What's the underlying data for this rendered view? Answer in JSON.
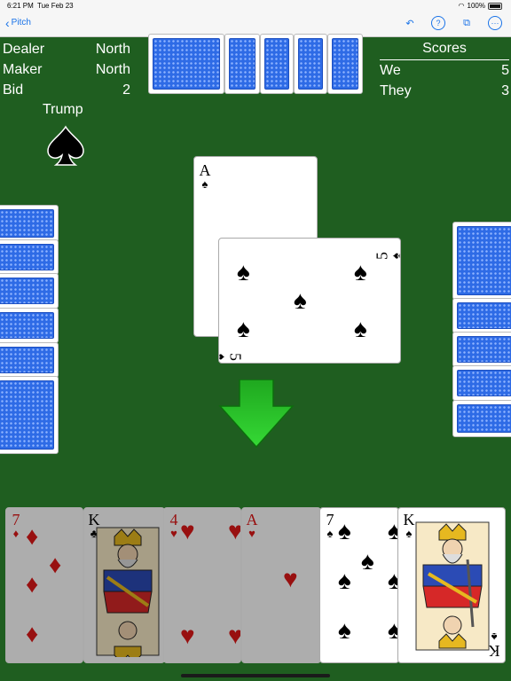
{
  "status": {
    "time": "6:21 PM",
    "date": "Tue Feb 23",
    "battery": "100%"
  },
  "nav": {
    "back_label": "Pitch",
    "icons": [
      "undo-icon",
      "help-icon",
      "deal-icon",
      "more-icon"
    ]
  },
  "game_info": {
    "dealer_label": "Dealer",
    "dealer_value": "North",
    "maker_label": "Maker",
    "maker_value": "North",
    "bid_label": "Bid",
    "bid_value": "2",
    "trump_label": "Trump",
    "trump_suit": "♠"
  },
  "scores": {
    "title": "Scores",
    "we_label": "We",
    "we_value": "5",
    "they_label": "They",
    "they_value": "3"
  },
  "trick": [
    {
      "rank": "A",
      "suit": "♠",
      "center_pip": ""
    },
    {
      "rank": "5",
      "suit": "♠",
      "pips": [
        "♠",
        "♠",
        "♠",
        "♠",
        "♠"
      ]
    }
  ],
  "hand": [
    {
      "rank": "7",
      "suit": "♦",
      "color": "red",
      "playable": false
    },
    {
      "rank": "K",
      "suit": "♣",
      "color": "black",
      "playable": false
    },
    {
      "rank": "4",
      "suit": "♥",
      "color": "red",
      "playable": false
    },
    {
      "rank": "A",
      "suit": "♥",
      "color": "red",
      "playable": false
    },
    {
      "rank": "7",
      "suit": "♠",
      "color": "black",
      "playable": true
    },
    {
      "rank": "K",
      "suit": "♠",
      "color": "black",
      "playable": true
    }
  ],
  "colors": {
    "felt": "#1f5e20",
    "card_back": "#2e6be6",
    "arrow": "#20b020",
    "accent": "#1a73e8"
  }
}
